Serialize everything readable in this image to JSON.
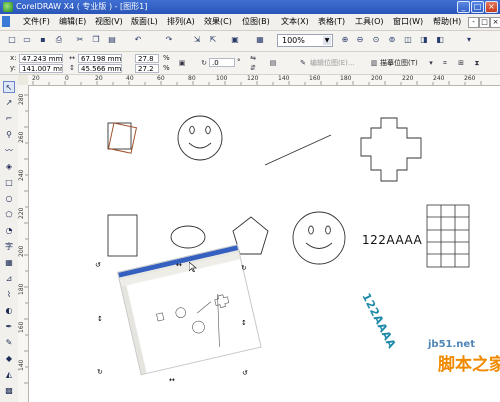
{
  "window": {
    "title": "CorelDRAW X4 ( 专业版 ) - [图形1]",
    "controls": [
      "_",
      "□",
      "×"
    ]
  },
  "menu": {
    "items": [
      "文件(F)",
      "编辑(E)",
      "视图(V)",
      "版面(L)",
      "排列(A)",
      "效果(C)",
      "位图(B)",
      "文本(X)",
      "表格(T)",
      "工具(O)",
      "窗口(W)",
      "帮助(H)"
    ],
    "doc_controls": [
      "-",
      "□",
      "×"
    ]
  },
  "toolbar": {
    "zoom": "100%"
  },
  "property_bar": {
    "x_label": "x:",
    "x_value": "47.243 mm",
    "y_label": "y:",
    "y_value": "141.007 mm",
    "width_value": "67.198 mm",
    "height_value": "45.566 mm",
    "scale_x": "27.8",
    "scale_y": "27.2",
    "percent": "%",
    "rotation": ".0",
    "rotation_unit": "°",
    "edit_bitmap": "编辑位图(E)...",
    "trace_bitmap": "描摹位图(T)"
  },
  "ruler": {
    "h_labels": [
      "20",
      "0",
      "20",
      "40",
      "60",
      "80",
      "100",
      "120",
      "140",
      "160",
      "180",
      "200",
      "220",
      "240",
      "260"
    ],
    "v_labels": [
      "280",
      "260",
      "240",
      "220",
      "200",
      "180",
      "160",
      "140"
    ]
  },
  "canvas": {
    "text_horizontal": "122AAAA",
    "text_rotated": "122AAAA",
    "shape_colors": {
      "outline": "#333333",
      "rotated_square": "#a0522d",
      "text_rotated": "#1f8aa8"
    }
  },
  "watermark": {
    "url": "jb51.net",
    "name": "脚本之家"
  }
}
